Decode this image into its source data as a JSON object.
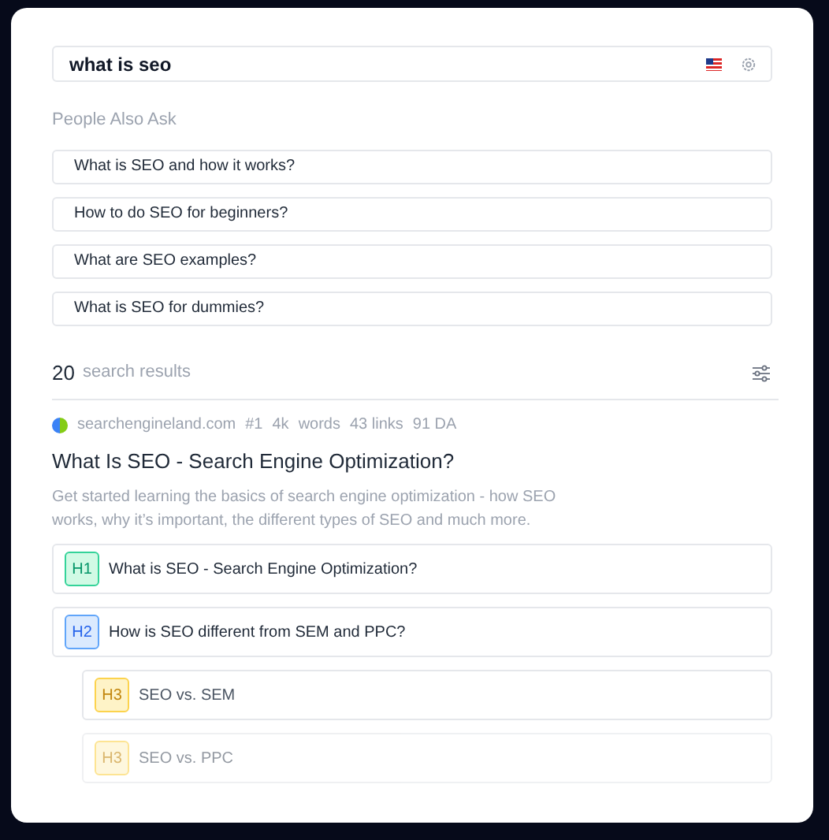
{
  "search": {
    "value": "what is seo"
  },
  "people_also_ask": {
    "title": "People Also Ask",
    "questions": [
      "What is SEO and how it works?",
      "How to do SEO for beginners?",
      "What are SEO examples?",
      "What is SEO for dummies?"
    ]
  },
  "results": {
    "count": "20",
    "label": "search results"
  },
  "result": {
    "meta": [
      "searchengineland.com",
      "#1",
      "4k",
      "words",
      "43 links",
      "91 DA"
    ],
    "title": "What Is SEO - Search Engine Optimization?",
    "description": "Get started learning the basics of search engine optimization - how SEO works, why it’s important, the different types of SEO and much more.",
    "headings": [
      {
        "kind": "h1",
        "tag": "H1",
        "text": "What is SEO - Search Engine Optimization?",
        "faded": false
      },
      {
        "kind": "h2",
        "tag": "H2",
        "text": "How is SEO different from SEM and PPC?",
        "faded": false,
        "children": [
          {
            "kind": "h3",
            "tag": "H3",
            "text": "SEO vs. SEM",
            "faded": false
          },
          {
            "kind": "h3",
            "tag": "H3",
            "text": "SEO vs. PPC",
            "faded": true
          }
        ]
      }
    ]
  }
}
